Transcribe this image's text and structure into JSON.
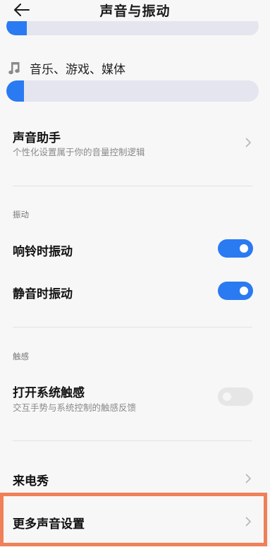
{
  "header": {
    "title": "声音与振动"
  },
  "volume": {
    "top_level": 0.08,
    "media_label": "音乐、游戏、媒体",
    "media_level": 0.07
  },
  "sound_assistant": {
    "title": "声音助手",
    "subtitle": "个性化设置属于你的音量控制逻辑"
  },
  "vibration": {
    "section": "振动",
    "ring": {
      "label": "响铃时振动",
      "on": true
    },
    "silent": {
      "label": "静音时振动",
      "on": true
    }
  },
  "haptics": {
    "section": "触感",
    "system": {
      "title": "打开系统触感",
      "subtitle": "交互手势与系统控制的触感反馈",
      "on": false
    }
  },
  "caller_show": {
    "title": "来电秀"
  },
  "more": {
    "title": "更多声音设置"
  },
  "colors": {
    "accent": "#2a7af2",
    "highlight": "#f08057"
  }
}
